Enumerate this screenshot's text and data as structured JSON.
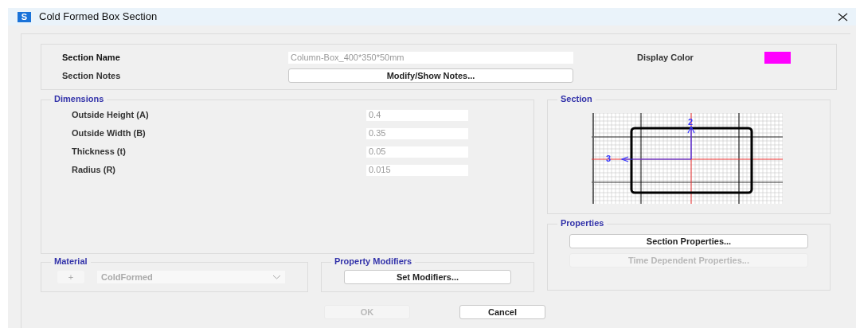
{
  "window": {
    "title": "Cold Formed Box Section",
    "app_badge": "S"
  },
  "section_name": {
    "label": "Section Name",
    "value": "Column-Box_400*350*50mm"
  },
  "section_notes": {
    "label": "Section Notes",
    "button": "Modify/Show Notes..."
  },
  "display_color": {
    "label": "Display Color",
    "color": "#ff00ff"
  },
  "dimensions": {
    "title": "Dimensions",
    "fields": [
      {
        "label": "Outside Height (A)",
        "value": "0.4"
      },
      {
        "label": "Outside Width (B)",
        "value": "0.35"
      },
      {
        "label": "Thickness (t)",
        "value": "0.05"
      },
      {
        "label": "Radius (R)",
        "value": "0.015"
      }
    ]
  },
  "section_preview": {
    "title": "Section",
    "axis_labels": [
      "2",
      "3"
    ]
  },
  "properties": {
    "title": "Properties",
    "buttons": [
      {
        "label": "Section Properties...",
        "disabled": false
      },
      {
        "label": "Time Dependent Properties...",
        "disabled": true
      }
    ]
  },
  "material": {
    "title": "Material",
    "add_button": "+",
    "value": "ColdFormed"
  },
  "property_modifiers": {
    "title": "Property Modifiers",
    "button": "Set Modifiers..."
  },
  "footer": {
    "buttons": [
      {
        "label": "OK",
        "disabled": true
      },
      {
        "label": "Cancel",
        "disabled": false
      }
    ]
  }
}
